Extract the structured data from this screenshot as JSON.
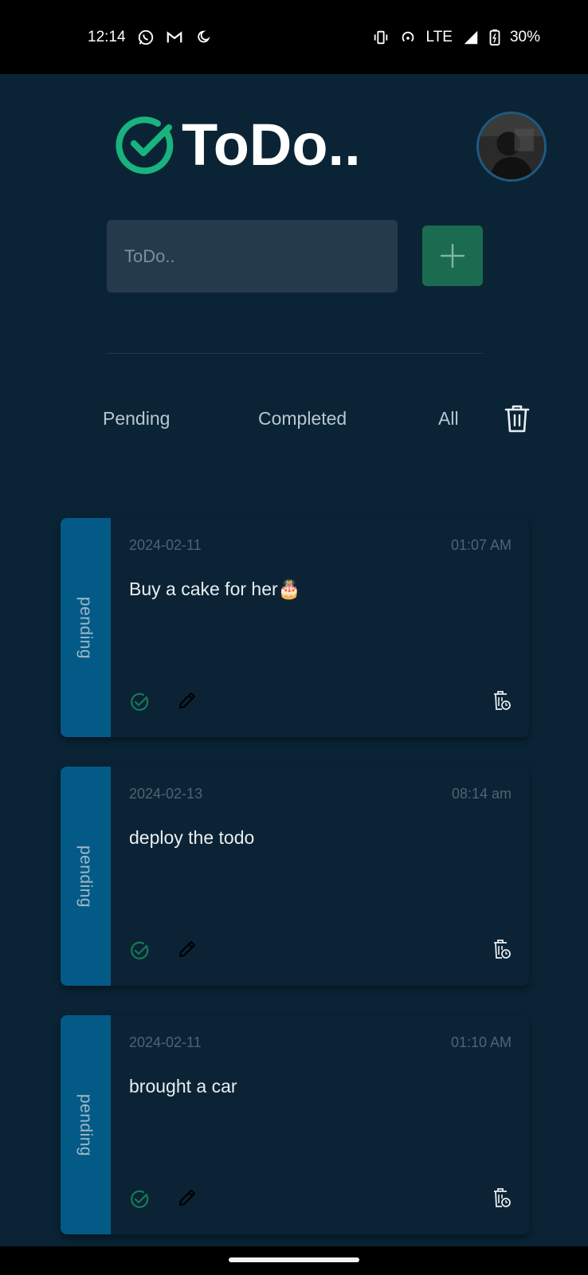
{
  "status_bar": {
    "time": "12:14",
    "left_icons": [
      "whatsapp-icon",
      "gmail-icon",
      "moon-icon"
    ],
    "network": "LTE",
    "battery": "30%"
  },
  "header": {
    "app_name": "ToDo..",
    "logo_color": "#19b37d"
  },
  "new_todo": {
    "placeholder": "ToDo..",
    "value": ""
  },
  "tabs": {
    "pending": "Pending",
    "completed": "Completed",
    "all": "All"
  },
  "todos": [
    {
      "status": "pending",
      "date": "2024-02-11",
      "time": "01:07 AM",
      "text": "Buy a cake for her🎂"
    },
    {
      "status": "pending",
      "date": "2024-02-13",
      "time": "08:14 am",
      "text": "deploy the todo"
    },
    {
      "status": "pending",
      "date": "2024-02-11",
      "time": "01:10 AM",
      "text": "brought a car"
    }
  ],
  "colors": {
    "background": "#0a2436",
    "accent_green": "#19b37d",
    "add_button": "#1a6b4f",
    "status_strip": "#045a86"
  }
}
